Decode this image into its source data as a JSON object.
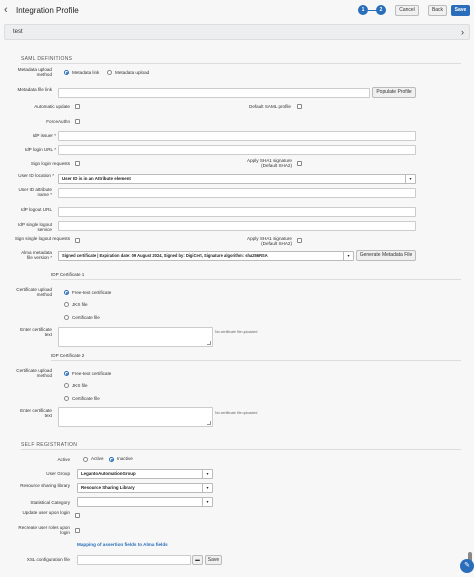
{
  "header": {
    "back_icon": "chevron-left-icon",
    "title": "Integration Profile",
    "steps": [
      "1",
      "2"
    ],
    "cancel_label": "Cancel",
    "back_label": "Back",
    "save_label": "Save",
    "colors": {
      "accent": "#2a6ebb"
    }
  },
  "profile_card": {
    "label": "test",
    "chevron_icon": "chevron-right-icon"
  },
  "saml": {
    "section_title": "SAML DEFINITIONS",
    "metadata_method_label": "Metadata upload method",
    "metadata_method_options": [
      "Metadata link",
      "Metadata upload"
    ],
    "metadata_method_selected": "Metadata link",
    "metadata_link_label": "Metadata file link",
    "metadata_link_value": "",
    "populate_label": "Populate Profile",
    "auto_update_label": "Automatic update",
    "default_saml_label": "Default SAML profile",
    "force_authn_label": "ForceAuthn",
    "idp_issuer_label": "IdP issuer *",
    "idp_login_label": "IdP login URL *",
    "sign_login_label": "Sign login requests",
    "sha1_label": "Apply SHA1 signature (Default SHA2)",
    "user_id_location_label": "User ID location *",
    "user_id_location_value": "User ID is in an Attribute element",
    "user_id_attr_label": "User ID attribute name *",
    "idp_logout_label": "IdP logout URL",
    "idp_single_logout_label": "IdP single logout service",
    "sign_single_logout_label": "Sign single logout requests",
    "sha1_logout_label": "Apply SHA1 signature (Default SHA2)",
    "alma_metadata_label": "Alma metadata file version *",
    "alma_metadata_value": "Signed certificate | Expiration date: 09 August  2024, Signed by: DigiCert, Signature algorithm: sha256RSA",
    "generate_label": "Generate Metadata File"
  },
  "idp_cert_1": {
    "title": "IDP Certificate 1",
    "method_label": "Certificate upload method",
    "options": [
      "Free-text certificate",
      "JKS file",
      "Certificate file"
    ],
    "selected": "Free-text certificate",
    "enter_label": "Enter certificate text",
    "note": "No certificate file uploaded"
  },
  "idp_cert_2": {
    "title": "IDP Certificate 2",
    "method_label": "Certificate upload method",
    "options": [
      "Free-text certificate",
      "JKS file",
      "Certificate file"
    ],
    "selected": "Free-text certificate",
    "enter_label": "Enter certificate text",
    "note": "No certificate file uploaded"
  },
  "self_reg": {
    "section_title": "SELF REGISTRATION",
    "active_label": "Active",
    "active_options": [
      "Active",
      "Inactive"
    ],
    "active_selected": "Inactive",
    "user_group_label": "User Group",
    "user_group_value": "LegantoAutomationGroup",
    "rs_library_label": "Resource sharing library",
    "rs_library_value": "Resource Sharing Library",
    "stat_category_label": "Statistical Category",
    "stat_category_value": "",
    "update_user_label": "Update user upon login",
    "recreate_roles_label": "Recreate user roles upon login",
    "mapping_link": "Mapping of assertion fields to Alma fields",
    "xsl_label": "XSL configuration file",
    "xsl_save_label": "Save",
    "folder_icon": "folder-icon"
  },
  "fab_icon": "chat-icon"
}
